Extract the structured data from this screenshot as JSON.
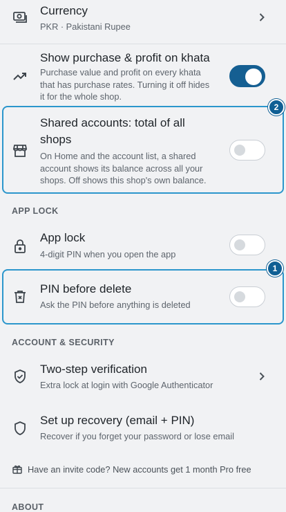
{
  "currency": {
    "title": "Currency",
    "value": "PKR · Pakistani Rupee",
    "icon": "cash-icon"
  },
  "purchase_profit": {
    "title": "Show purchase & profit on khata",
    "desc_lines": [
      "Purchase value and profit on every khata",
      "that has purchase rates. Turning it off hides",
      "it for the whole shop."
    ],
    "enabled": true
  },
  "shared_accounts": {
    "title_lines": [
      "Shared accounts: total of all",
      "shops"
    ],
    "desc_lines": [
      "On Home and the account list, a shared",
      "account shows its balance across all your",
      "shops. Off shows this shop's own balance."
    ],
    "enabled": false,
    "badge": "2"
  },
  "section_app_lock": "APP LOCK",
  "app_lock": {
    "title": "App lock",
    "desc": "4-digit PIN when you open the app",
    "enabled": false
  },
  "pin_delete": {
    "title": "PIN before delete",
    "desc": "Ask the PIN before anything is deleted",
    "enabled": false,
    "badge": "1"
  },
  "section_account_security": "ACCOUNT & SECURITY",
  "two_step": {
    "title": "Two-step verification",
    "desc": "Extra lock at login with Google Authenticator"
  },
  "recovery": {
    "title": "Set up recovery (email + PIN)",
    "desc": "Recover if you forget your password or lose email"
  },
  "invite": "Have an invite code? New accounts get 1 month Pro free",
  "section_about": "ABOUT",
  "colors": {
    "accent": "#155f92",
    "highlight": "#2b96cc",
    "background": "#f1f2f4"
  }
}
